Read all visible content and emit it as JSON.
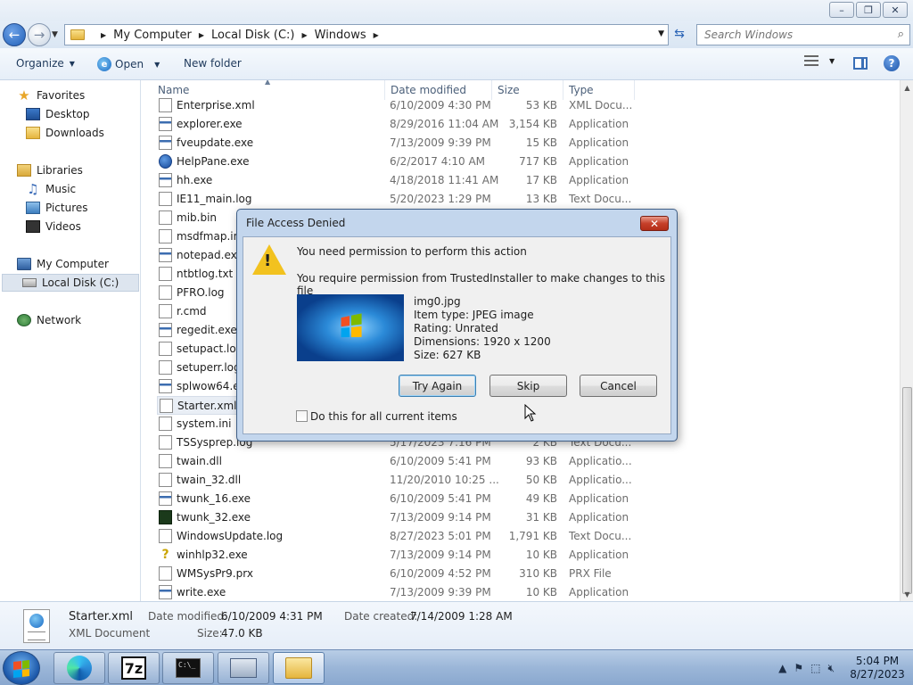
{
  "window": {
    "caption_buttons": [
      "minimize-icon",
      "restore-icon",
      "close-icon"
    ]
  },
  "address": {
    "crumbs": [
      "My Computer",
      "Local Disk (C:)",
      "Windows"
    ],
    "search_placeholder": "Search Windows"
  },
  "toolbar": {
    "organize": "Organize",
    "open": "Open",
    "new_folder": "New folder"
  },
  "nav": {
    "favorites": "Favorites",
    "desktop": "Desktop",
    "downloads": "Downloads",
    "libraries": "Libraries",
    "music": "Music",
    "pictures": "Pictures",
    "videos": "Videos",
    "my_computer": "My Computer",
    "local_disk": "Local Disk (C:)",
    "network": "Network"
  },
  "columns": {
    "name": "Name",
    "date": "Date modified",
    "size": "Size",
    "type": "Type"
  },
  "files": [
    {
      "name": "Enterprise.xml",
      "date": "6/10/2009 4:30 PM",
      "size": "53 KB",
      "type": "XML Docu..."
    },
    {
      "name": "explorer.exe",
      "date": "8/29/2016 11:04 AM",
      "size": "3,154 KB",
      "type": "Application"
    },
    {
      "name": "fveupdate.exe",
      "date": "7/13/2009 9:39 PM",
      "size": "15 KB",
      "type": "Application"
    },
    {
      "name": "HelpPane.exe",
      "date": "6/2/2017 4:10 AM",
      "size": "717 KB",
      "type": "Application"
    },
    {
      "name": "hh.exe",
      "date": "4/18/2018 11:41 AM",
      "size": "17 KB",
      "type": "Application"
    },
    {
      "name": "IE11_main.log",
      "date": "5/20/2023 1:29 PM",
      "size": "13 KB",
      "type": "Text Docu..."
    },
    {
      "name": "mib.bin",
      "date": "",
      "size": "",
      "type": ""
    },
    {
      "name": "msdfmap.ini",
      "date": "",
      "size": "",
      "type": ""
    },
    {
      "name": "notepad.exe",
      "date": "",
      "size": "",
      "type": ""
    },
    {
      "name": "ntbtlog.txt",
      "date": "",
      "size": "",
      "type": ""
    },
    {
      "name": "PFRO.log",
      "date": "",
      "size": "",
      "type": ""
    },
    {
      "name": "r.cmd",
      "date": "",
      "size": "",
      "type": ""
    },
    {
      "name": "regedit.exe",
      "date": "",
      "size": "",
      "type": ""
    },
    {
      "name": "setupact.log",
      "date": "",
      "size": "",
      "type": ""
    },
    {
      "name": "setuperr.log",
      "date": "",
      "size": "",
      "type": ""
    },
    {
      "name": "splwow64.exe",
      "date": "",
      "size": "",
      "type": ""
    },
    {
      "name": "Starter.xml",
      "date": "",
      "size": "",
      "type": ""
    },
    {
      "name": "system.ini",
      "date": "",
      "size": "",
      "type": ""
    },
    {
      "name": "TSSysprep.log",
      "date": "5/17/2023 7:16 PM",
      "size": "2 KB",
      "type": "Text Docu..."
    },
    {
      "name": "twain.dll",
      "date": "6/10/2009 5:41 PM",
      "size": "93 KB",
      "type": "Applicatio..."
    },
    {
      "name": "twain_32.dll",
      "date": "11/20/2010 10:25 ...",
      "size": "50 KB",
      "type": "Applicatio..."
    },
    {
      "name": "twunk_16.exe",
      "date": "6/10/2009 5:41 PM",
      "size": "49 KB",
      "type": "Application"
    },
    {
      "name": "twunk_32.exe",
      "date": "7/13/2009 9:14 PM",
      "size": "31 KB",
      "type": "Application"
    },
    {
      "name": "WindowsUpdate.log",
      "date": "8/27/2023 5:01 PM",
      "size": "1,791 KB",
      "type": "Text Docu..."
    },
    {
      "name": "winhlp32.exe",
      "date": "7/13/2009 9:14 PM",
      "size": "10 KB",
      "type": "Application"
    },
    {
      "name": "WMSysPr9.prx",
      "date": "6/10/2009 4:52 PM",
      "size": "310 KB",
      "type": "PRX File"
    },
    {
      "name": "write.exe",
      "date": "7/13/2009 9:39 PM",
      "size": "10 KB",
      "type": "Application"
    }
  ],
  "details": {
    "name": "Starter.xml",
    "type": "XML Document",
    "modified_label": "Date modified:",
    "modified_value": "6/10/2009 4:31 PM",
    "created_label": "Date created:",
    "created_value": "7/14/2009 1:28 AM",
    "size_label": "Size:",
    "size_value": "47.0 KB"
  },
  "dialog": {
    "title": "File Access Denied",
    "heading": "You need permission to perform this action",
    "message": "You require permission from TrustedInstaller to make changes to this file",
    "file_name": "img0.jpg",
    "item_type": "Item type: JPEG image",
    "rating": "Rating: Unrated",
    "dimensions": "Dimensions: 1920 x 1200",
    "size": "Size: 627 KB",
    "try_again": "Try Again",
    "skip": "Skip",
    "cancel": "Cancel",
    "checkbox_label": "Do this for all current items"
  },
  "taskbar": {
    "time": "5:04 PM",
    "date": "8/27/2023",
    "apps": [
      "edge-icon",
      "7zip-icon",
      "cmd-icon",
      "keyboard-icon",
      "explorer-icon"
    ]
  }
}
